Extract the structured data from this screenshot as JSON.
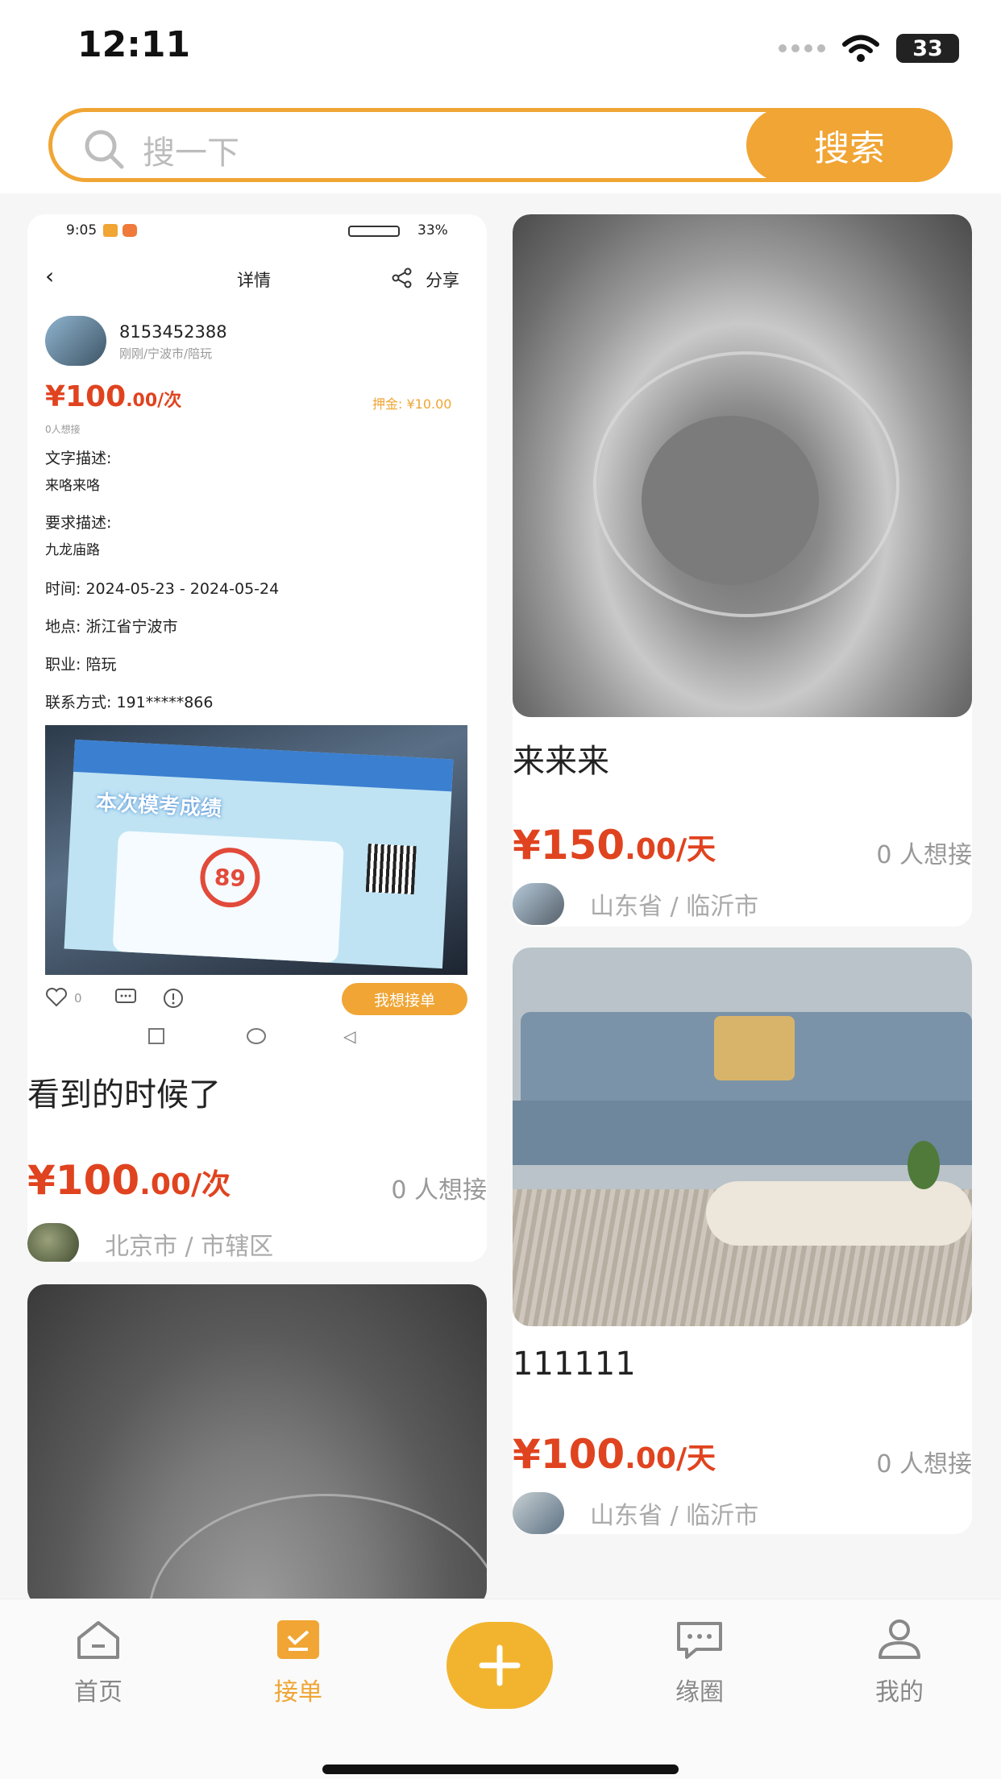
{
  "status_bar": {
    "time": "12:11",
    "battery": "33"
  },
  "search": {
    "placeholder": "搜一下",
    "button_label": "搜索"
  },
  "cards": [
    {
      "title": "看到的时候了",
      "price": "¥100",
      "price_unit": ".00/次",
      "want": "0 人想接",
      "location": "北京市 / 市辖区",
      "screenshot": {
        "time": "9:05",
        "battery": "33%",
        "header_title": "详情",
        "share_label": "分享",
        "user_id": "8153452388",
        "user_meta": "刚刚/宁波市/陪玩",
        "price": "¥100",
        "price_unit": ".00/次",
        "deposit_label": "押金:",
        "deposit_value": "¥10.00",
        "want": "0人想接",
        "text_desc_label": "文字描述:",
        "text_desc_value": "来咯来咯",
        "req_desc_label": "要求描述:",
        "req_desc_value": "九龙庙路",
        "time_row": "时间:  2024-05-23 - 2024-05-24",
        "place_row": "地点:  浙江省宁波市",
        "job_row": "职业:  陪玩",
        "contact_row": "联系方式:  191*****866",
        "photo_text": "本次模考成绩",
        "photo_score": "89",
        "like_count": "0",
        "take_button": "我想接单"
      }
    },
    {
      "title": "来来来",
      "price": "¥150",
      "price_unit": ".00/天",
      "want": "0 人想接",
      "location": "山东省 / 临沂市"
    },
    {
      "title": "111111",
      "price": "¥100",
      "price_unit": ".00/天",
      "want": "0 人想接",
      "location": "山东省 / 临沂市"
    }
  ],
  "tabbar": {
    "items": [
      {
        "label": "首页",
        "icon": "home-icon"
      },
      {
        "label": "接单",
        "icon": "checklist-icon"
      },
      {
        "label": "",
        "icon": "plus-icon"
      },
      {
        "label": "缘圈",
        "icon": "chat-bubble-icon"
      },
      {
        "label": "我的",
        "icon": "person-icon"
      }
    ],
    "active": "接单"
  },
  "colors": {
    "accent": "#f0a534",
    "price": "#e0431f"
  }
}
